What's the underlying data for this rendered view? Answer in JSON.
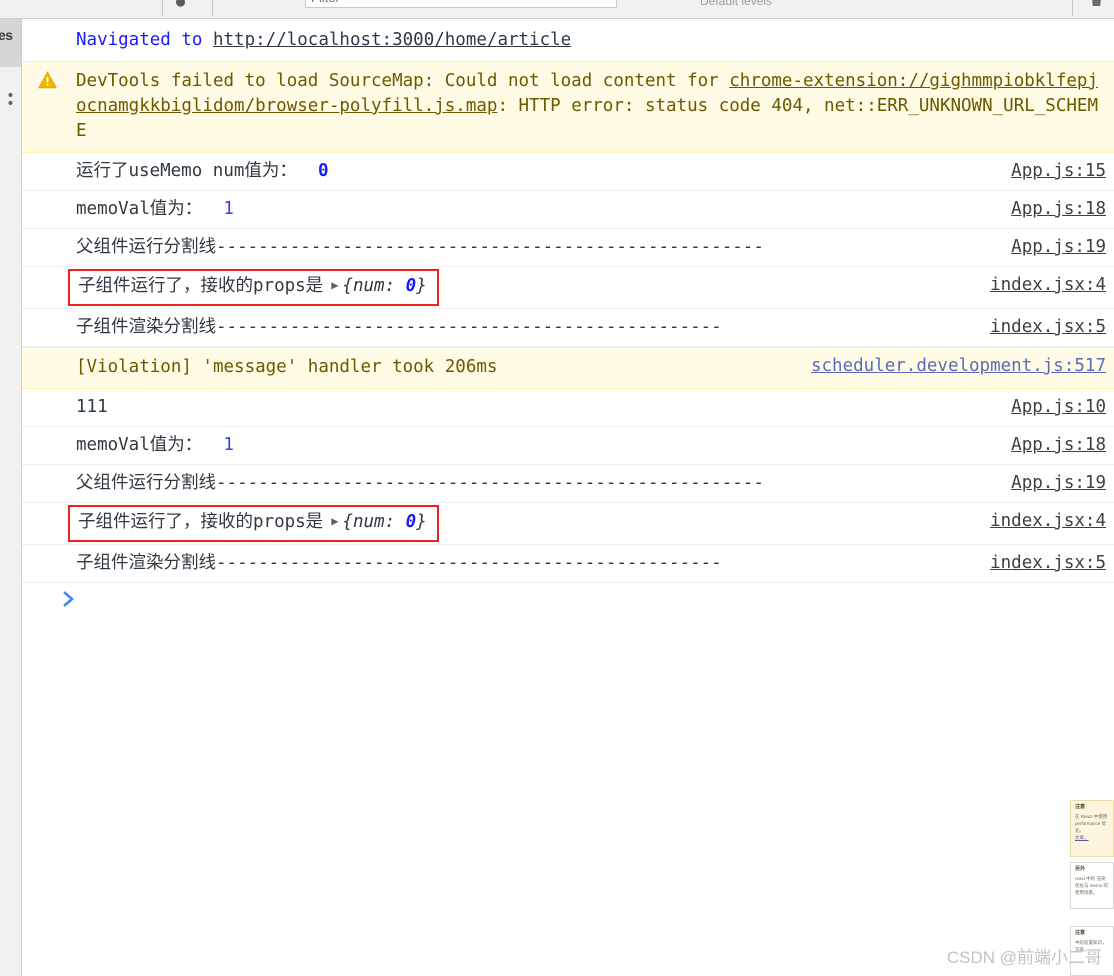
{
  "toolbar": {
    "filter_placeholder": "Filter",
    "levels_label": "Default levels",
    "clear_icon": "trash-icon",
    "no_issues_icon": "circle-slash-icon"
  },
  "sidebar": {
    "active_tab_label": "es",
    "more_label": "• •"
  },
  "console": {
    "navigated": {
      "label": "Navigated to",
      "url": "http://localhost:3000/home/article"
    },
    "sourcemap_warning": {
      "icon": "warning-triangle-icon",
      "part1": "DevTools failed to load SourceMap: Could not load content for ",
      "link": "chrome-extension://gighmmpiobklfepjocnamgkkbiglidom/browser-polyfill.js.map",
      "part2": ": HTTP error: status code 404, net::ERR_UNKNOWN_URL_SCHEME"
    },
    "messages": [
      {
        "text": "运行了useMemo num值为：",
        "value": "0",
        "source": "App.js:15"
      },
      {
        "text": "memoVal值为：",
        "value": "1",
        "source": "App.js:18"
      },
      {
        "text": "父组件运行分割线----------------------------------------------------",
        "source": "App.js:19"
      },
      {
        "text": "子组件运行了，接收的props是",
        "expander": "▶",
        "preview_open": "{num: ",
        "preview_value": "0",
        "preview_close": "}",
        "source": "index.jsx:4",
        "highlighted": true
      },
      {
        "text": "子组件渲染分割线------------------------------------------------",
        "source": "index.jsx:5"
      },
      {
        "text": "[Violation] 'message' handler took 206ms",
        "source": "scheduler.development.js:517",
        "level": "warning"
      },
      {
        "text": "111",
        "source": "App.js:10"
      },
      {
        "text": "memoVal值为：",
        "value": "1",
        "source": "App.js:18"
      },
      {
        "text": "父组件运行分割线----------------------------------------------------",
        "source": "App.js:19"
      },
      {
        "text": "子组件运行了，接收的props是",
        "expander": "▶",
        "preview_open": "{num: ",
        "preview_value": "0",
        "preview_close": "}",
        "source": "index.jsx:4",
        "highlighted": true
      },
      {
        "text": "子组件渲染分割线------------------------------------------------",
        "source": "index.jsx:5"
      }
    ],
    "prompt_icon": "chevron-right-icon"
  },
  "notes": [
    {
      "title": "注意",
      "body": "在 React 中使用 performance 优化。",
      "link": "文章。"
    },
    {
      "title": "另外",
      "body": "react 中的 渲染优化与 memo 的使用场景。"
    },
    {
      "title": "注意",
      "body": "中的前置知识，渲染。"
    }
  ],
  "watermark": "CSDN @前端小二哥",
  "colors": {
    "link_blue": "#1a1aff",
    "warning_bg": "#fffbe5",
    "warning_text": "#6b5900",
    "highlight_box": "#ef2020",
    "prompt_blue": "#4285f4"
  }
}
